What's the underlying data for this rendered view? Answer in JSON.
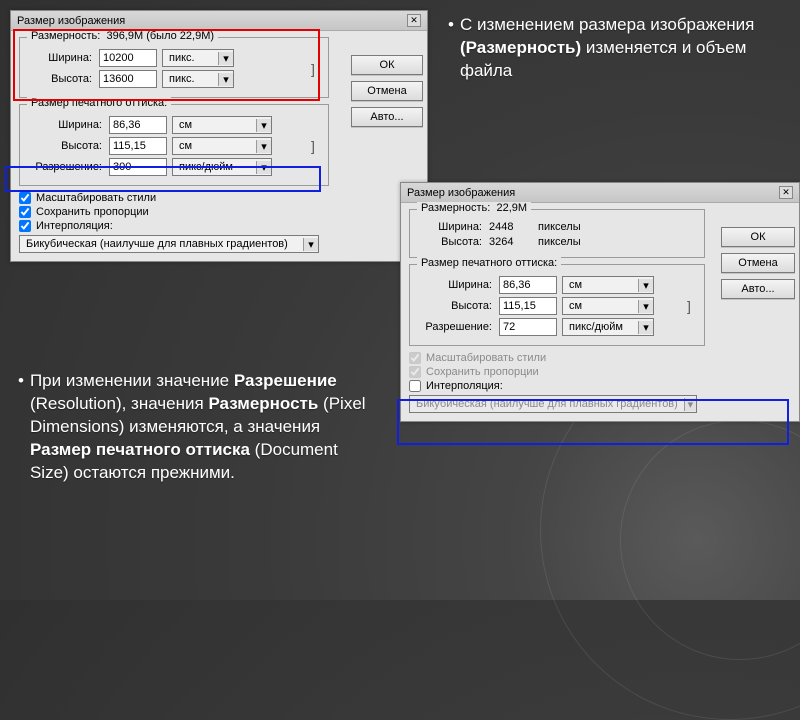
{
  "notes": {
    "top": "С изменением размера изображения (Размерность) изменяется и объем файла",
    "top_plain1": "С изменением размера изображения ",
    "top_bold1": "(Размерность)",
    "top_plain2": " изменяется и объем файла",
    "bottom_p1": "При изменении значение ",
    "bottom_b1": "Разрешение",
    "bottom_p2": " (Resolution), значения ",
    "bottom_b2": "Размерность",
    "bottom_p3": " (Pixel Dimensions) изменяются, а значения ",
    "bottom_b3": "Размер печатного оттиска",
    "bottom_p4": " (Document Size) остаются прежними."
  },
  "common": {
    "title": "Размер изображения",
    "ok": "ОК",
    "cancel": "Отмена",
    "auto": "Авто...",
    "dim_label": "Размерность:",
    "width": "Ширина:",
    "height": "Высота:",
    "print_group": "Размер печатного оттиска:",
    "resolution": "Разрешение:",
    "scale_styles": "Масштабировать стили",
    "keep_ratio": "Сохранить пропорции",
    "interp": "Интерполяция:",
    "interp_method": "Бикубическая (наилучше для плавных градиентов)",
    "dd": "▾",
    "brace": "]"
  },
  "dlg1": {
    "dim_value": "396,9М (было 22,9М)",
    "width": "10200",
    "height": "13600",
    "unit_px": "пикс.",
    "print_width": "86,36",
    "print_height": "115,15",
    "unit_cm": "см",
    "res": "300",
    "unit_res": "пикс/дюйм"
  },
  "dlg2": {
    "dim_value": "22,9М",
    "width": "2448",
    "height": "3264",
    "unit_px": "пикселы",
    "print_width": "86,36",
    "print_height": "115,15",
    "unit_cm": "см",
    "res": "72",
    "unit_res": "пикс/дюйм"
  }
}
